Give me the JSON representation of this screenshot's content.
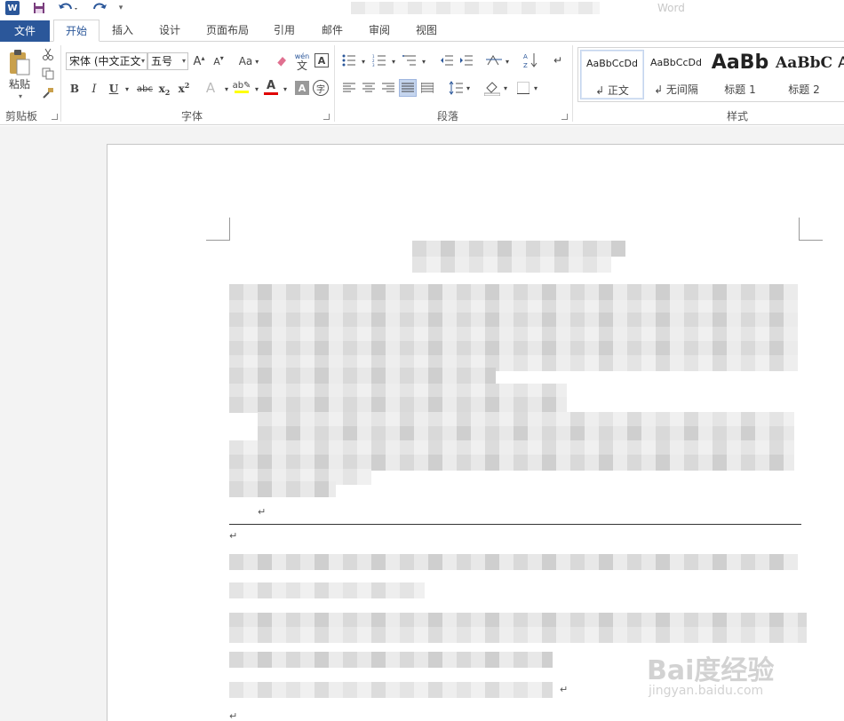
{
  "app": {
    "logo": "W",
    "title_tail": "Word"
  },
  "quick_access": {
    "save_icon": "save-icon",
    "undo_icon": "undo-icon",
    "redo_icon": "redo-icon"
  },
  "tabs": [
    {
      "label": "文件"
    },
    {
      "label": "开始"
    },
    {
      "label": "插入"
    },
    {
      "label": "设计"
    },
    {
      "label": "页面布局"
    },
    {
      "label": "引用"
    },
    {
      "label": "邮件"
    },
    {
      "label": "审阅"
    },
    {
      "label": "视图"
    }
  ],
  "clipboard": {
    "paste_label": "粘贴",
    "group_label": "剪贴板"
  },
  "font": {
    "font_name": "宋体 (中文正文",
    "font_size": "五号",
    "grow": "A",
    "shrink": "A",
    "change_case": "Aa",
    "phonetic": "wén",
    "phonetic_char": "文",
    "border_char": "A",
    "bold": "B",
    "italic": "I",
    "underline": "U",
    "strike": "abc",
    "subscript": "x",
    "subscript_mark": "2",
    "superscript": "x",
    "superscript_mark": "2",
    "effect": "A",
    "color": "A",
    "shade": "A",
    "enclose": "字",
    "group_label": "字体"
  },
  "paragraph": {
    "group_label": "段落"
  },
  "styles": {
    "group_label": "样式",
    "items": [
      {
        "preview": "AaBbCcDd",
        "name": "↲ 正文"
      },
      {
        "preview": "AaBbCcDd",
        "name": "↲ 无间隔"
      },
      {
        "preview": "AaBb",
        "name": "标题 1"
      },
      {
        "preview": "AaBbC",
        "name": "标题 2"
      },
      {
        "preview": "A",
        "name": ""
      }
    ]
  },
  "colors": {
    "accent": "#2b579a",
    "font_color_bar": "#e00000",
    "highlight_bar": "#ffff00"
  },
  "watermark": {
    "main": "Bai度经验",
    "sub": "jingyan.baidu.com"
  },
  "doc": {
    "para_mark": "↵"
  }
}
